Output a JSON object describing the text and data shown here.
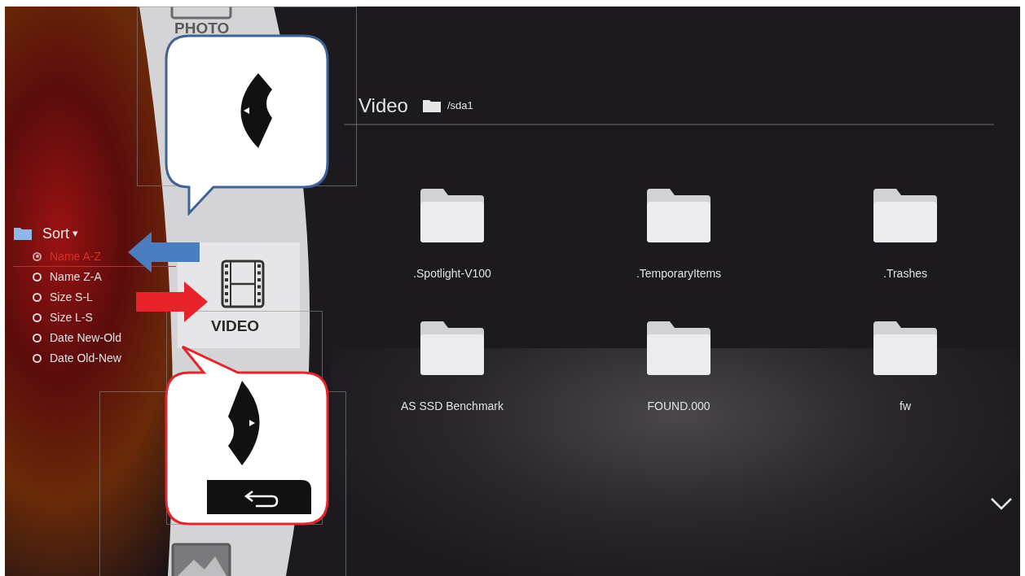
{
  "sort": {
    "label": "Sort",
    "caret": "▾",
    "options": [
      {
        "label": "Name A-Z",
        "selected": true
      },
      {
        "label": "Name Z-A",
        "selected": false
      },
      {
        "label": "Size S-L",
        "selected": false
      },
      {
        "label": "Size L-S",
        "selected": false
      },
      {
        "label": "Date New-Old",
        "selected": false
      },
      {
        "label": "Date Old-New",
        "selected": false
      }
    ]
  },
  "wheel": {
    "items": [
      {
        "kind": "photo",
        "label": "PHOTO",
        "selected": false
      },
      {
        "kind": "video",
        "label": "VIDEO",
        "selected": true
      },
      {
        "kind": "image",
        "selected": false
      }
    ]
  },
  "header": {
    "title": "Video",
    "path": "/sda1"
  },
  "folders": [
    {
      "name": ".Spotlight-V100"
    },
    {
      "name": ".TemporaryItems"
    },
    {
      "name": ".Trashes"
    },
    {
      "name": "AS SSD Benchmark"
    },
    {
      "name": "FOUND.000"
    },
    {
      "name": "fw"
    }
  ],
  "annotations": [
    {
      "kind": "arrow-left",
      "color": "#4a7dbf"
    },
    {
      "kind": "arrow-right",
      "color": "#e8242a"
    },
    {
      "kind": "callout-left-key",
      "color": "#3f6394"
    },
    {
      "kind": "callout-right-back-key",
      "color": "#e3262b"
    }
  ]
}
